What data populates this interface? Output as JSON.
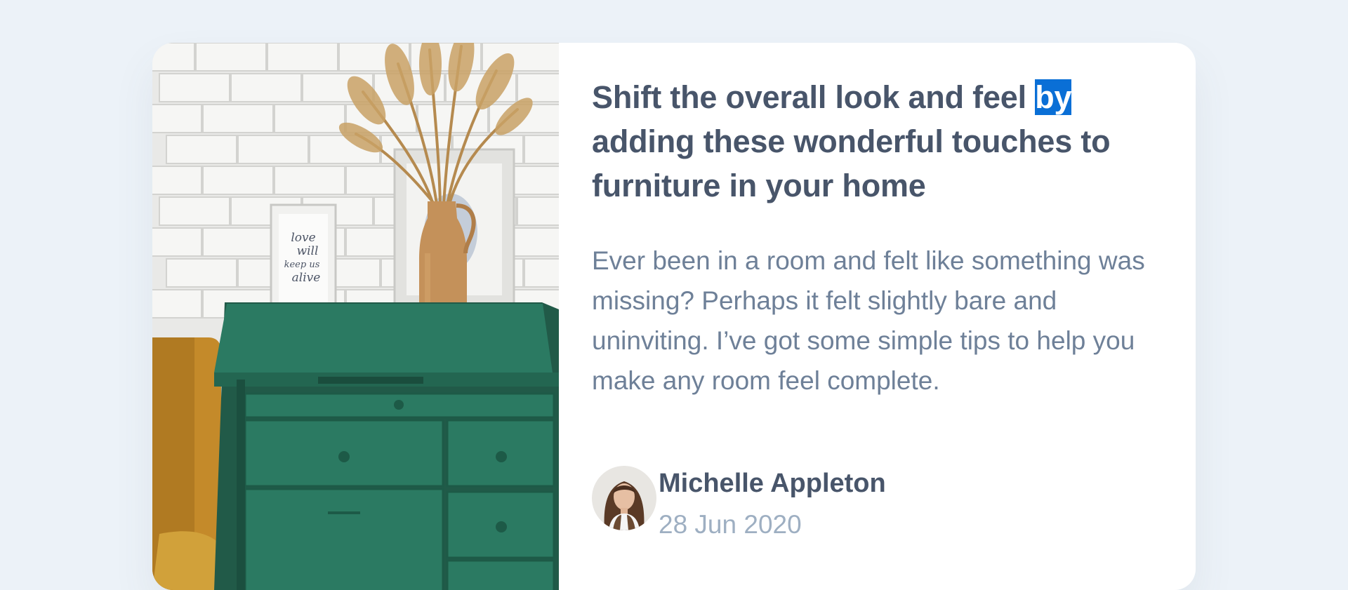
{
  "article": {
    "title_before": "Shift the overall look and feel ",
    "title_selected": "by",
    "title_after": " adding these wonderful touches to furniture in your home",
    "description": "Ever been in a room and felt like something was missing? Perhaps it felt slightly bare and uninviting. I’ve got some simple tips to help you make any room feel complete."
  },
  "photo": {
    "frame_text": [
      "love",
      "will",
      "keep us",
      "alive"
    ]
  },
  "author": {
    "name": "Michelle Appleton",
    "date": "28 Jun 2020"
  },
  "share": {
    "icon": "share-icon"
  },
  "colors": {
    "background": "#ecf2f8",
    "title": "#48556a",
    "body": "#6e8098",
    "muted": "#9eafc2",
    "selection": "#0a6fd6",
    "drawer_green": "#2b7a62"
  }
}
